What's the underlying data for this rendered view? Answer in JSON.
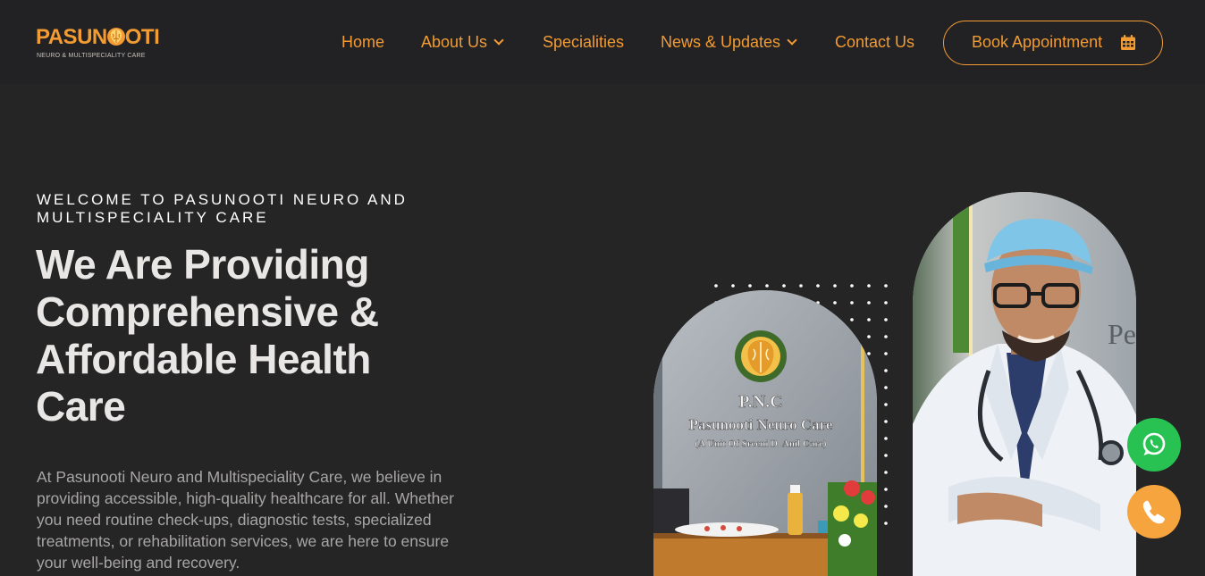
{
  "brand": {
    "name_prefix": "PASUN",
    "name_suffix": "OTI",
    "tagline": "NEURO & MULTISPECIALITY CARE",
    "accent_color": "#f29c33"
  },
  "nav": {
    "home": "Home",
    "about": "About Us",
    "specialities": "Specialities",
    "news": "News & Updates",
    "contact": "Contact Us",
    "book": "Book Appointment"
  },
  "hero": {
    "welcome": "WELCOME TO PASUNOOTI NEURO AND MULTISPECIALITY CARE",
    "headline": "We Are Providing Comprehensive & Affordable Health Care",
    "paragraph": "At Pasunooti Neuro and Multispeciality Care, we believe in providing accessible, high-quality healthcare for all. Whether you need routine check-ups, diagnostic tests, specialized treatments, or rehabilitation services, we are here to ensure your well-being and recovery."
  },
  "clinic_sign": {
    "initials": "P.N.C",
    "name": "Pasunooti Neuro Care",
    "sub": "(A Unit Of Sreeni D. Anil Care)"
  },
  "floating": {
    "whatsapp_icon": "whatsapp-icon",
    "whatsapp_color": "#28c253",
    "phone_icon": "phone-icon",
    "phone_color": "#f6a43e"
  }
}
